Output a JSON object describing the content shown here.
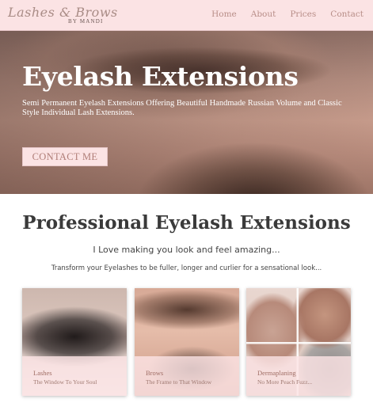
{
  "header": {
    "logo_script": "Lashes & Brows",
    "logo_by": "BY MANDI",
    "nav": [
      "Home",
      "About",
      "Prices",
      "Contact"
    ]
  },
  "hero": {
    "title": "Eyelash Extensions",
    "subtitle": "Semi Permanent Eyelash Extensions Offering Beautiful Handmade Russian Volume and Classic Style Individual Lash Extensions.",
    "button": "CONTACT ME"
  },
  "main": {
    "title": "Professional Eyelash Extensions",
    "tagline": "I Love making you look and feel amazing...",
    "description": "Transform your Eyelashes to be fuller, longer and curlier for a sensational look..."
  },
  "cards": [
    {
      "title": "Lashes",
      "subtitle": "The Window To Your Soul"
    },
    {
      "title": "Brows",
      "subtitle": "The Frame to That Window"
    },
    {
      "title": "Dermaplaning",
      "subtitle": "No More Peach Fuzz..."
    }
  ],
  "colors": {
    "header_bg": "#fbe3e4",
    "nav_text": "#b88e88",
    "accent": "#b07e78",
    "caption_bg": "#fbe3e4"
  }
}
